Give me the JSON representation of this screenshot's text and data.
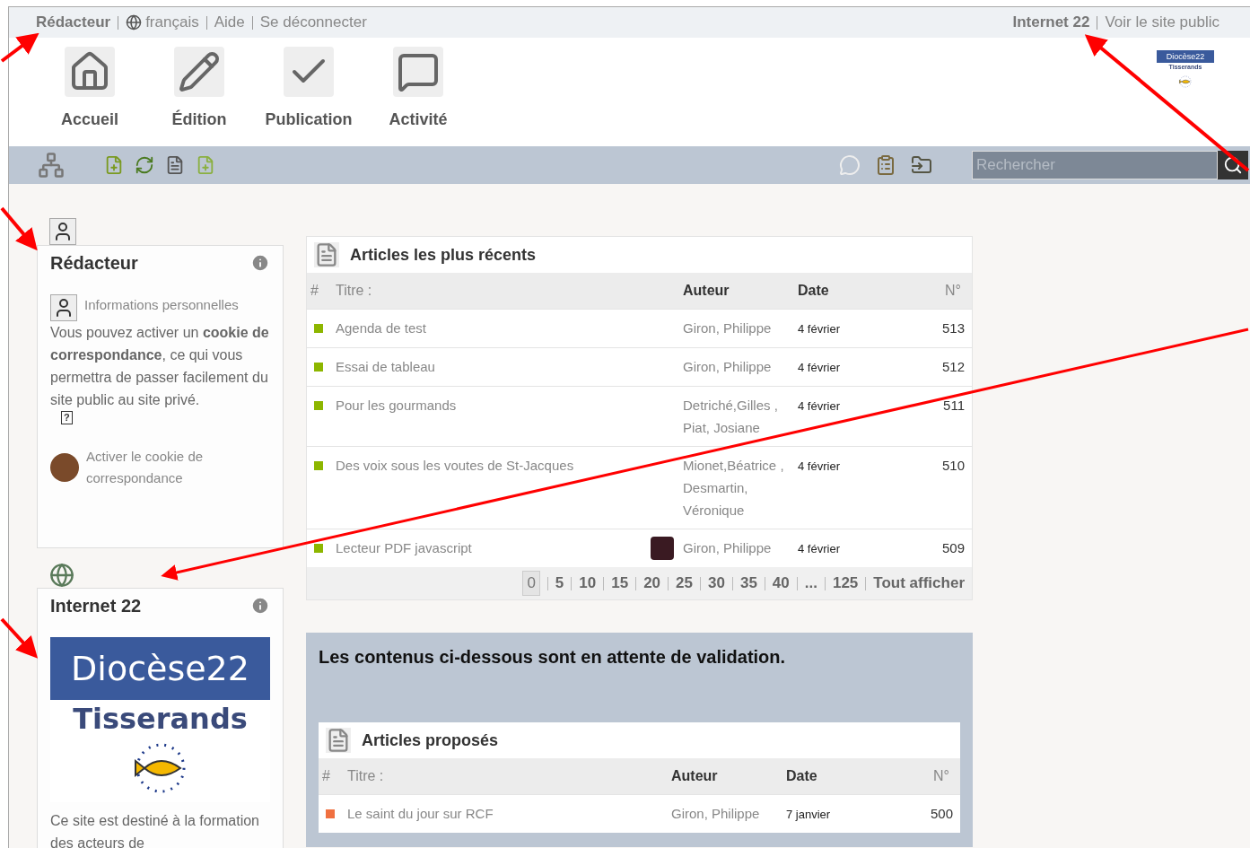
{
  "top_bar": {
    "user": "Rédacteur",
    "language": "français",
    "links": [
      "Aide",
      "Se déconnecter"
    ],
    "site": "Internet 22",
    "public_link": "Voir le site public"
  },
  "site_logo": {
    "name": "Diocèse22",
    "subtitle": "Tisserands"
  },
  "nav": [
    {
      "label": "Accueil",
      "kind": "home"
    },
    {
      "label": "Édition",
      "kind": "edit"
    },
    {
      "label": "Publication",
      "kind": "publish"
    },
    {
      "label": "Activité",
      "kind": "activity"
    }
  ],
  "search": {
    "placeholder": "Rechercher"
  },
  "author_box": {
    "title": "Rédacteur",
    "personal_info": "Informations personnelles",
    "text": "Vous pouvez activer un **cookie de correspondance**, ce qui vous permettra de passer facilement du site public au site privé.",
    "help_mark": "?",
    "cookie_link": "Activer le cookie de correspondance"
  },
  "site_box": {
    "title": "Internet 22",
    "logo": {
      "name": "Diocèse22",
      "subtitle": "Tisserands"
    },
    "description": "Ce site est destiné à la formation des acteurs de"
  },
  "recent_articles": {
    "title": "Articles les plus récents",
    "columns": [
      "#",
      "Titre :",
      "Auteur",
      "Date",
      "N°"
    ],
    "rows": [
      {
        "title": "Agenda de test",
        "author": "Giron, Philippe",
        "date": "4 février",
        "number": "513",
        "color": "#8db600",
        "thumbnail": false
      },
      {
        "title": "Essai de tableau",
        "author": "Giron, Philippe",
        "date": "4 février",
        "number": "512",
        "color": "#8db600",
        "thumbnail": false
      },
      {
        "title": "Pour les gourmands",
        "author": "Detriché,Gilles , Piat, Josiane",
        "date": "4 février",
        "number": "511",
        "color": "#8db600",
        "thumbnail": false
      },
      {
        "title": "Des voix sous les voutes de St-Jacques",
        "author": "Mionet,Béatrice , Desmartin, Véronique",
        "date": "4 février",
        "number": "510",
        "color": "#8db600",
        "thumbnail": false
      },
      {
        "title": "Lecteur PDF javascript",
        "author": "Giron, Philippe",
        "date": "4 février",
        "number": "509",
        "color": "#8db600",
        "thumbnail": true
      }
    ],
    "pages": [
      {
        "label": "0",
        "selected": true
      },
      {
        "label": "5",
        "selected": false
      },
      {
        "label": "10",
        "selected": false
      },
      {
        "label": "15",
        "selected": false
      },
      {
        "label": "20",
        "selected": false
      },
      {
        "label": "25",
        "selected": false
      },
      {
        "label": "30",
        "selected": false
      },
      {
        "label": "35",
        "selected": false
      },
      {
        "label": "40",
        "selected": false
      },
      {
        "label": "...",
        "selected": false
      },
      {
        "label": "125",
        "selected": false
      },
      {
        "label": "Tout afficher",
        "selected": false
      }
    ]
  },
  "pending": {
    "notice": "Les contenus ci-dessous sont en attente de validation.",
    "title": "Articles proposés",
    "columns": [
      "#",
      "Titre :",
      "Auteur",
      "Date",
      "N°"
    ],
    "rows": [
      {
        "title": "Le saint du jour sur RCF",
        "author": "Giron, Philippe",
        "date": "7 janvier",
        "number": "500",
        "color": "#f07040",
        "thumbnail": false
      }
    ]
  }
}
